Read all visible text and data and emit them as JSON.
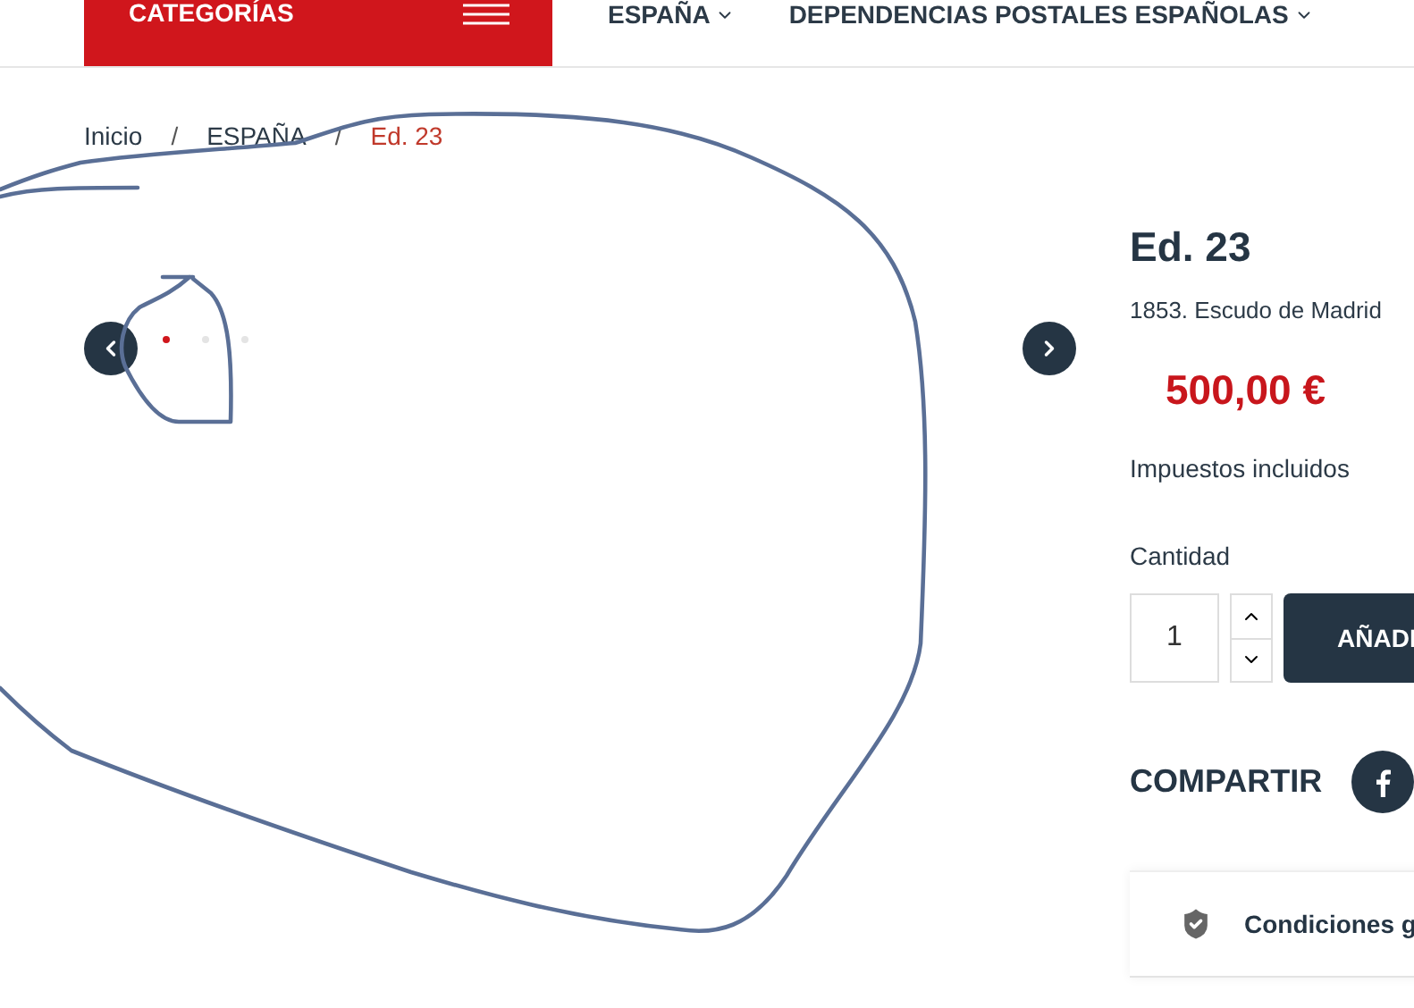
{
  "header": {
    "categories_label": "CATEGORÍAS",
    "nav": [
      {
        "label": "ESPAÑA"
      },
      {
        "label": "DEPENDENCIAS POSTALES ESPAÑOLAS"
      }
    ]
  },
  "breadcrumb": [
    {
      "label": "Inicio",
      "current": false
    },
    {
      "label": "ESPAÑA",
      "current": false
    },
    {
      "label": "Ed. 23",
      "current": true
    }
  ],
  "breadcrumb_separator": "/",
  "carousel": {
    "dots": [
      {
        "selected": true
      },
      {
        "selected": false
      },
      {
        "selected": false
      }
    ]
  },
  "product": {
    "title": "Ed. 23",
    "subtitle": "1853. Escudo de Madrid",
    "price": "500,00 €",
    "tax_note": "Impuestos incluidos",
    "quantity_label": "Cantidad",
    "quantity": "1",
    "add_button": "AÑADI",
    "share_label": "COMPARTIR",
    "conditions": "Condiciones g"
  }
}
